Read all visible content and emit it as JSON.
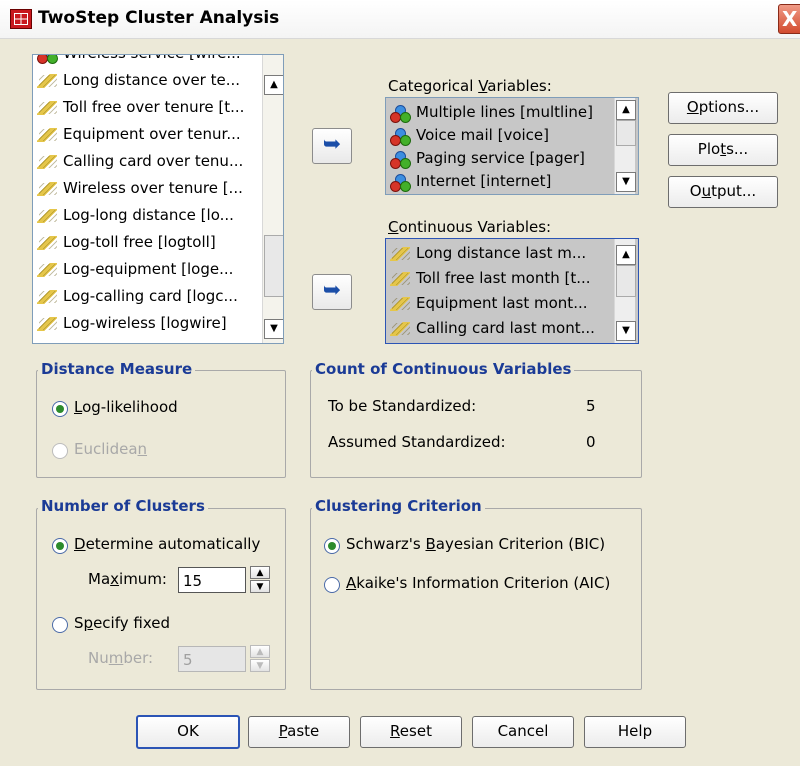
{
  "window": {
    "title": "TwoStep Cluster Analysis",
    "close_symbol": "X"
  },
  "source_list": {
    "items": [
      {
        "label": "Wireless service [wire...",
        "icon": "balls-icon"
      },
      {
        "label": "Long distance over te...",
        "icon": "ruler-icon"
      },
      {
        "label": "Toll free over tenure [t...",
        "icon": "ruler-icon"
      },
      {
        "label": "Equipment over tenur...",
        "icon": "ruler-icon"
      },
      {
        "label": "Calling card over tenu...",
        "icon": "ruler-icon"
      },
      {
        "label": "Wireless over tenure [...",
        "icon": "ruler-icon"
      },
      {
        "label": "Log-long distance [lo...",
        "icon": "ruler-icon"
      },
      {
        "label": "Log-toll free [logtoll]",
        "icon": "ruler-icon"
      },
      {
        "label": "Log-equipment [loge...",
        "icon": "ruler-icon"
      },
      {
        "label": "Log-calling card [logc...",
        "icon": "ruler-icon"
      },
      {
        "label": "Log-wireless [logwire]",
        "icon": "ruler-icon"
      }
    ]
  },
  "categorical": {
    "label_pre": "Categorical ",
    "label_u": "V",
    "label_post": "ariables:",
    "items": [
      {
        "label": "Multiple lines [multline]",
        "icon": "balls-icon"
      },
      {
        "label": "Voice mail [voice]",
        "icon": "balls-icon"
      },
      {
        "label": "Paging service [pager]",
        "icon": "balls-icon"
      },
      {
        "label": "Internet [internet]",
        "icon": "balls-icon"
      }
    ]
  },
  "continuous": {
    "label_u": "C",
    "label_post": "ontinuous Variables:",
    "items": [
      {
        "label": "Long distance last m...",
        "icon": "ruler-icon"
      },
      {
        "label": "Toll free last month [t...",
        "icon": "ruler-icon"
      },
      {
        "label": "Equipment last mont...",
        "icon": "ruler-icon"
      },
      {
        "label": "Calling card last mont...",
        "icon": "ruler-icon"
      }
    ]
  },
  "side_buttons": {
    "options_u": "O",
    "options_post": "ptions...",
    "plots_pre": "Plo",
    "plots_u": "t",
    "plots_post": "s...",
    "output_pre": "O",
    "output_u": "u",
    "output_post": "tput..."
  },
  "distance_measure": {
    "title": "Distance Measure",
    "loglik_u": "L",
    "loglik_post": "og-likelihood",
    "euclid_pre": "Euclidea",
    "euclid_u": "n",
    "selected": "Log-likelihood"
  },
  "count_continuous": {
    "title": "Count of Continuous Variables",
    "to_be_label": "To be Standardized:",
    "to_be_value": "5",
    "assumed_label": "Assumed Standardized:",
    "assumed_value": "0"
  },
  "num_clusters": {
    "title": "Number of Clusters",
    "auto_u": "D",
    "auto_post": "etermine automatically",
    "max_pre": "Ma",
    "max_u": "x",
    "max_post": "imum:",
    "max_value": "15",
    "fixed_pre": "S",
    "fixed_u": "p",
    "fixed_post": "ecify fixed",
    "number_pre": "Nu",
    "number_u": "m",
    "number_post": "ber:",
    "number_value": "5",
    "selected": "Determine automatically"
  },
  "criterion": {
    "title": "Clustering Criterion",
    "bic_pre": "Schwarz's ",
    "bic_u": "B",
    "bic_post": "ayesian Criterion (BIC)",
    "aic_u": "A",
    "aic_post": "kaike's Information Criterion (AIC)",
    "selected": "BIC"
  },
  "bottom_buttons": {
    "ok": "OK",
    "paste_u": "P",
    "paste_post": "aste",
    "reset_u": "R",
    "reset_post": "eset",
    "cancel": "Cancel",
    "help": "Help"
  },
  "colors": {
    "group_title": "#1b3b96",
    "dialog_bg": "#ece9d8",
    "selected_list_bg": "#c7c7c7"
  }
}
